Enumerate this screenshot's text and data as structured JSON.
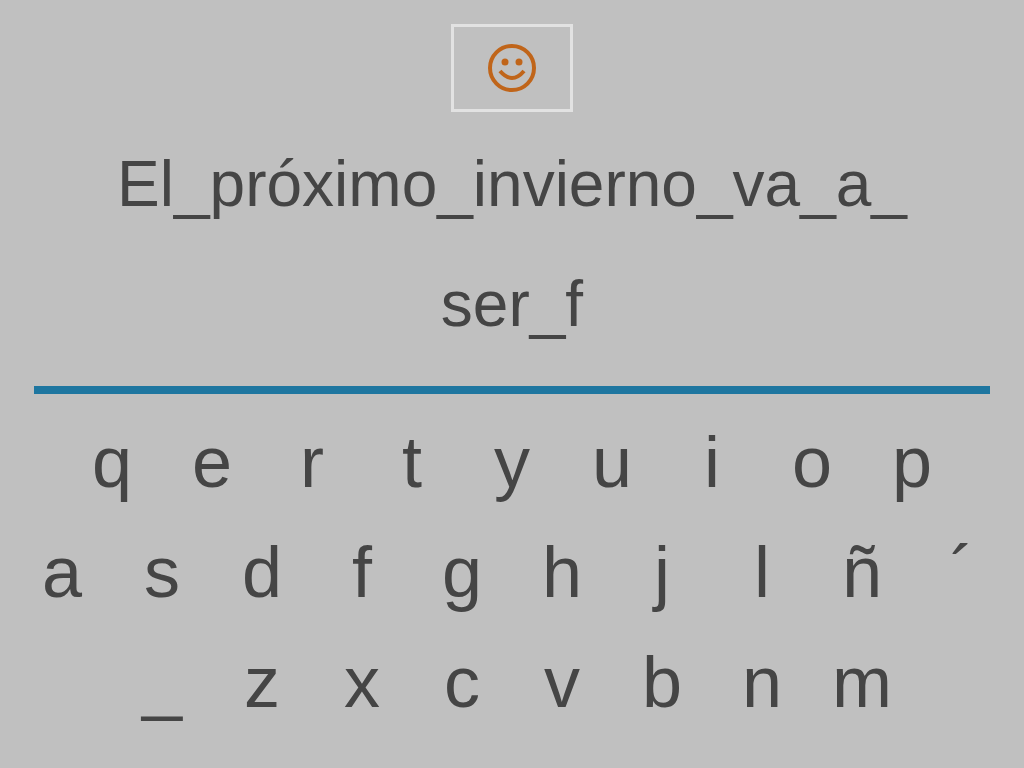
{
  "status": {
    "kind": "correct"
  },
  "sentence_lines": [
    "El_próximo_invierno_va_a_",
    "ser_f"
  ],
  "keyboard_rows": [
    [
      "q",
      "e",
      "r",
      "t",
      "y",
      "u",
      "i",
      "o",
      "p"
    ],
    [
      "a",
      "s",
      "d",
      "f",
      "g",
      "h",
      "j",
      "l",
      "ñ",
      "´"
    ],
    [
      "_",
      "z",
      "x",
      "c",
      "v",
      "b",
      "n",
      "m"
    ]
  ]
}
